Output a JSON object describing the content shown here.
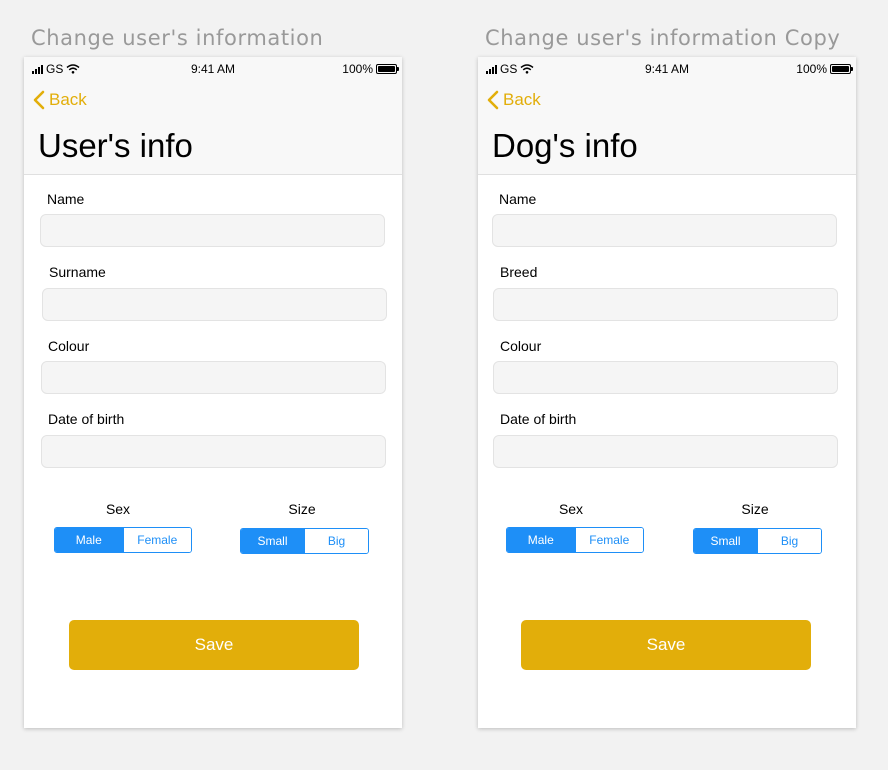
{
  "colors": {
    "accent": "#e2ae0a",
    "segment_blue": "#1e8ff7",
    "canvas": "#f2f2f2"
  },
  "boards": [
    {
      "artboard_title": "Change user's information",
      "status": {
        "carrier": "GS",
        "time": "9:41 AM",
        "battery": "100%"
      },
      "back_label": "Back",
      "page_title": "User's info",
      "fields": [
        {
          "label": "Name",
          "value": "",
          "placeholder": ""
        },
        {
          "label": "Surname",
          "value": "",
          "placeholder": ""
        },
        {
          "label": "Colour",
          "value": "",
          "placeholder": ""
        },
        {
          "label": "Date of birth",
          "value": "",
          "placeholder": ""
        }
      ],
      "sex": {
        "label": "Sex",
        "options": [
          "Male",
          "Female"
        ],
        "selected": "Male"
      },
      "size": {
        "label": "Size",
        "options": [
          "Small",
          "Big"
        ],
        "selected": "Small"
      },
      "save_label": "Save"
    },
    {
      "artboard_title": "Change user's information Copy",
      "status": {
        "carrier": "GS",
        "time": "9:41 AM",
        "battery": "100%"
      },
      "back_label": "Back",
      "page_title": "Dog's info",
      "fields": [
        {
          "label": "Name",
          "value": "",
          "placeholder": ""
        },
        {
          "label": "Breed",
          "value": "",
          "placeholder": ""
        },
        {
          "label": "Colour",
          "value": "",
          "placeholder": ""
        },
        {
          "label": "Date of birth",
          "value": "",
          "placeholder": ""
        }
      ],
      "sex": {
        "label": "Sex",
        "options": [
          "Male",
          "Female"
        ],
        "selected": "Male"
      },
      "size": {
        "label": "Size",
        "options": [
          "Small",
          "Big"
        ],
        "selected": "Small"
      },
      "save_label": "Save"
    }
  ]
}
